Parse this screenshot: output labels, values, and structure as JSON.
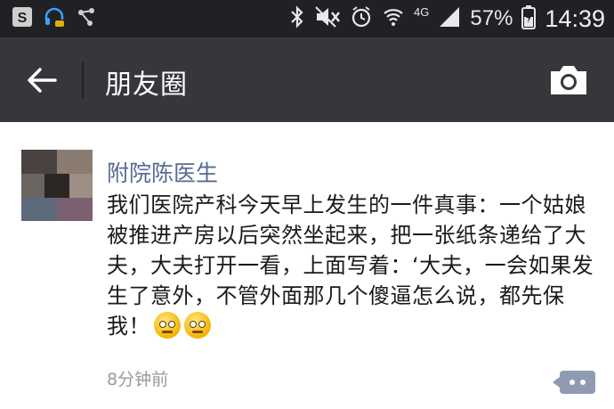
{
  "status_bar": {
    "icons": [
      "sim-icon",
      "headset-icon",
      "share-icon",
      "bluetooth-icon",
      "mute-icon",
      "alarm-icon",
      "wifi-icon",
      "signal-icon",
      "battery-icon"
    ],
    "network": "4G",
    "battery": "57%",
    "time": "14:39"
  },
  "header": {
    "title": "朋友圈",
    "back_icon": "back-arrow-icon",
    "camera_icon": "camera-icon"
  },
  "post": {
    "author": "附院陈医生",
    "text": "我们医院产科今天早上发生的一件真事：一个姑娘被推进产房以后突然坐起来，把一张纸条递给了大夫，大夫打开一看，上面写着：‘大夫，一会如果发生了意外，不管外面那几个傻逼怎么说，都先保我！",
    "emojis": [
      "sweat-smile-emoji",
      "sweat-smile-emoji"
    ],
    "timestamp": "8分钟前",
    "comment_icon": "comment-icon"
  },
  "colors": {
    "status_bg": "#202124",
    "nav_bg": "#35373a",
    "author_link": "#576b95",
    "timestamp": "#9a9a9a",
    "comment_btn": "#8e9bb0"
  }
}
